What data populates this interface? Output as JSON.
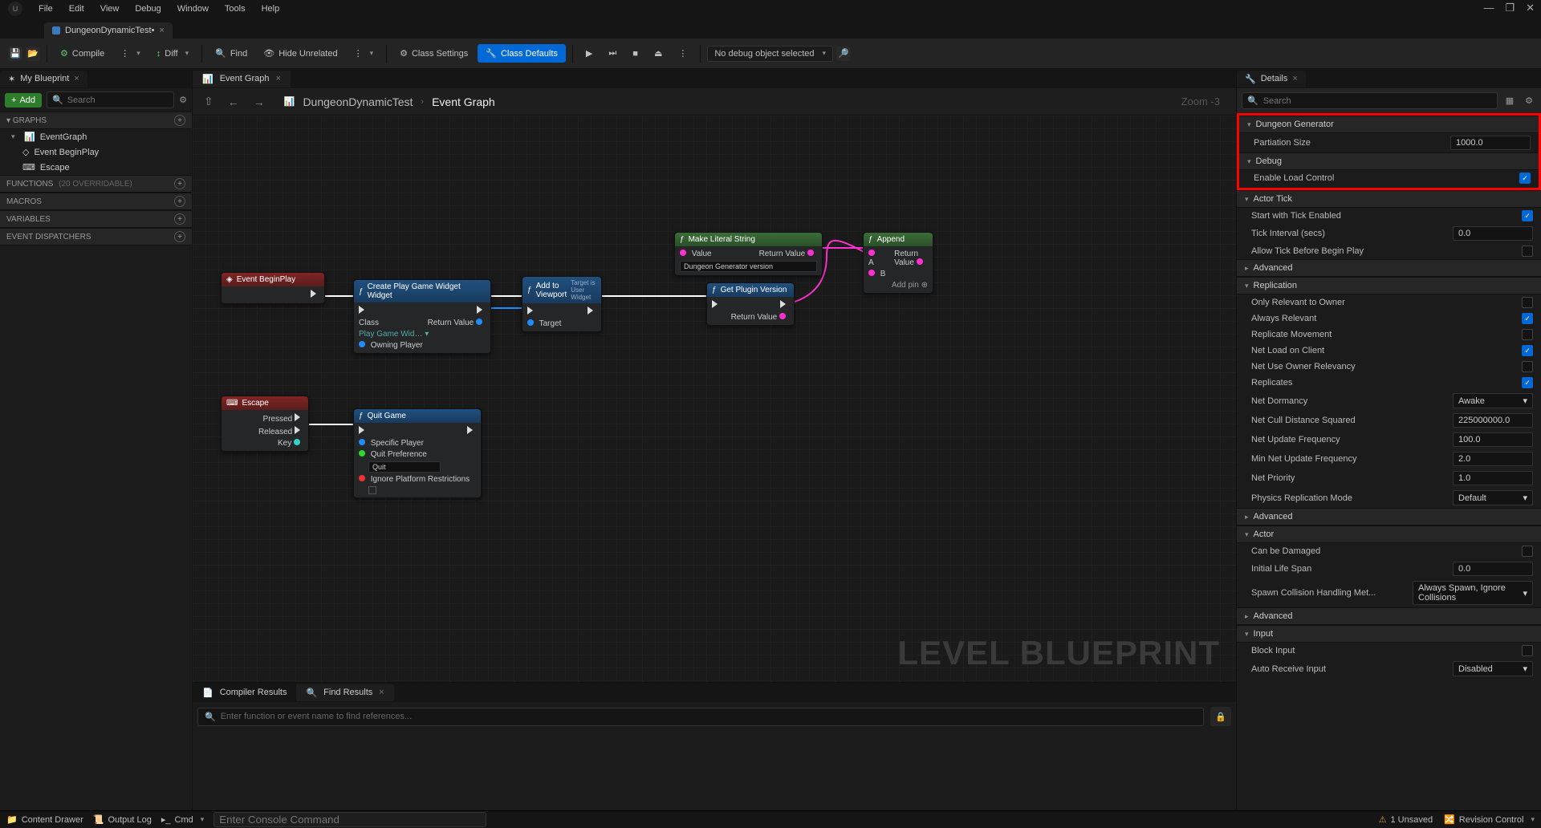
{
  "menu": {
    "items": [
      "File",
      "Edit",
      "View",
      "Debug",
      "Window",
      "Tools",
      "Help"
    ]
  },
  "fileTab": {
    "name": "DungeonDynamicTest•"
  },
  "toolbar": {
    "compile": "Compile",
    "diff": "Diff",
    "find": "Find",
    "hide": "Hide Unrelated",
    "classSettings": "Class Settings",
    "classDefaults": "Class Defaults",
    "debugSelect": "No debug object selected"
  },
  "leftPanel": {
    "tab": "My Blueprint",
    "addLabel": "Add",
    "searchPlaceholder": "Search",
    "sections": {
      "graphs": "GRAPHS",
      "functions": "FUNCTIONS",
      "functionsNote": "(20 OVERRIDABLE)",
      "macros": "MACROS",
      "variables": "VARIABLES",
      "dispatchers": "EVENT DISPATCHERS"
    },
    "graphTree": {
      "root": "EventGraph",
      "children": [
        "Event BeginPlay",
        "Escape"
      ]
    }
  },
  "centerTabs": {
    "eventGraph": "Event Graph"
  },
  "breadcrumb": {
    "a": "DungeonDynamicTest",
    "b": "Event Graph",
    "zoom": "Zoom -3"
  },
  "graph": {
    "watermark": "LEVEL BLUEPRINT",
    "nodes": {
      "beginPlay": "Event BeginPlay",
      "createWidget": "Create Play Game Widget Widget",
      "createWidget_class": "Class",
      "createWidget_classVal": "Play Game Wid…",
      "createWidget_owning": "Owning Player",
      "returnVal": "Return Value",
      "addViewport": "Add to Viewport",
      "addViewport_sub": "Target is User Widget",
      "target": "Target",
      "literal": "Make Literal String",
      "literal_value": "Value",
      "literal_valueText": "Dungeon Generator version",
      "plugin": "Get Plugin Version",
      "append": "Append",
      "append_a": "A",
      "append_b": "B",
      "addpin": "Add pin",
      "escape": "Escape",
      "escape_pressed": "Pressed",
      "escape_released": "Released",
      "escape_key": "Key",
      "quit": "Quit Game",
      "quit_player": "Specific Player",
      "quit_pref": "Quit Preference",
      "quit_prefVal": "Quit",
      "quit_ignore": "Ignore Platform Restrictions"
    }
  },
  "bottomPane": {
    "tab1": "Compiler Results",
    "tab2": "Find Results",
    "placeholder": "Enter function or event name to find references..."
  },
  "details": {
    "tab": "Details",
    "searchPlaceholder": "Search",
    "cats": {
      "dungeon": "Dungeon Generator",
      "debug": "Debug",
      "actorTick": "Actor Tick",
      "advanced": "Advanced",
      "replication": "Replication",
      "actor": "Actor",
      "input": "Input"
    },
    "props": {
      "partitionSize": {
        "label": "Partiation Size",
        "value": "1000.0"
      },
      "enableLoad": {
        "label": "Enable Load Control",
        "checked": true
      },
      "startTick": {
        "label": "Start with Tick Enabled",
        "checked": true
      },
      "tickInterval": {
        "label": "Tick Interval (secs)",
        "value": "0.0"
      },
      "allowTickBefore": {
        "label": "Allow Tick Before Begin Play",
        "checked": false
      },
      "onlyRelevant": {
        "label": "Only Relevant to Owner",
        "checked": false
      },
      "alwaysRelevant": {
        "label": "Always Relevant",
        "checked": true
      },
      "replicateMovement": {
        "label": "Replicate Movement",
        "checked": false
      },
      "netLoad": {
        "label": "Net Load on Client",
        "checked": true
      },
      "netUseOwner": {
        "label": "Net Use Owner Relevancy",
        "checked": false
      },
      "replicates": {
        "label": "Replicates",
        "checked": true
      },
      "netDormancy": {
        "label": "Net Dormancy",
        "value": "Awake"
      },
      "netCull": {
        "label": "Net Cull Distance Squared",
        "value": "225000000.0"
      },
      "netUpdate": {
        "label": "Net Update Frequency",
        "value": "100.0"
      },
      "minNetUpdate": {
        "label": "Min Net Update Frequency",
        "value": "2.0"
      },
      "netPriority": {
        "label": "Net Priority",
        "value": "1.0"
      },
      "physicsRep": {
        "label": "Physics Replication Mode",
        "value": "Default"
      },
      "canDamage": {
        "label": "Can be Damaged",
        "checked": false
      },
      "lifeSpan": {
        "label": "Initial Life Span",
        "value": "0.0"
      },
      "spawnCollision": {
        "label": "Spawn Collision Handling Met...",
        "value": "Always Spawn, Ignore Collisions"
      },
      "blockInput": {
        "label": "Block Input",
        "checked": false
      },
      "autoReceive": {
        "label": "Auto Receive Input",
        "value": "Disabled"
      }
    }
  },
  "statusbar": {
    "contentDrawer": "Content Drawer",
    "outputLog": "Output Log",
    "cmd": "Cmd",
    "consolePlaceholder": "Enter Console Command",
    "unsaved": "1 Unsaved",
    "revision": "Revision Control"
  }
}
